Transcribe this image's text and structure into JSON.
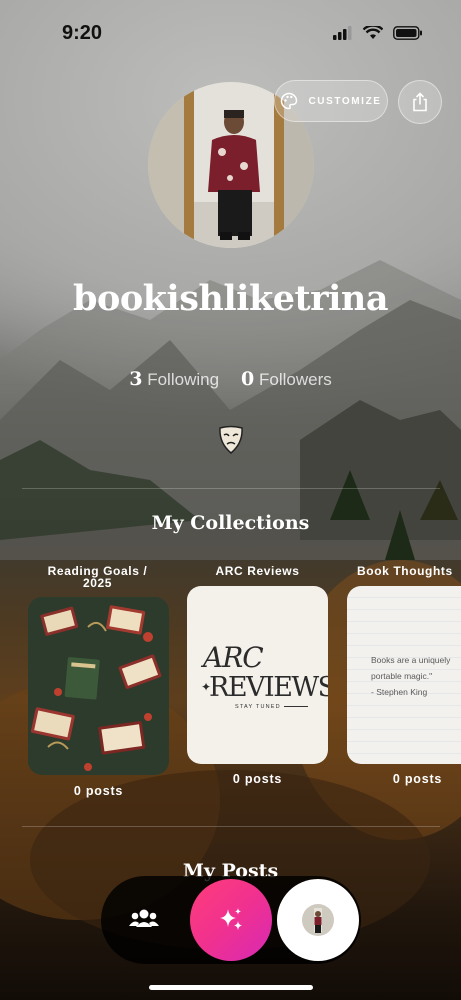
{
  "status_bar": {
    "time": "9:20"
  },
  "header": {
    "customize_label": "CUSTOMIZE"
  },
  "profile": {
    "username": "bookishliketrina",
    "following_count": "3",
    "following_label": "Following",
    "followers_count": "0",
    "followers_label": "Followers"
  },
  "collections_section": {
    "title": "My Collections",
    "items": [
      {
        "title_line1": "Reading Goals /",
        "title_line2": "2025",
        "posts": "0 posts"
      },
      {
        "title_line1": "ARC Reviews",
        "card_big1": "ARC",
        "card_big2": "REVIEWS",
        "card_small": "STAY TUNED",
        "posts": "0 posts"
      },
      {
        "title_line1": "Book Thoughts",
        "quote1": "Books are a uniquely",
        "quote2": "portable magic.\"",
        "quote3": "- Stephen King",
        "posts": "0 posts"
      }
    ]
  },
  "posts_section": {
    "title": "My Posts"
  },
  "colors": {
    "create_button": "#f0318f",
    "text": "#ffffff"
  },
  "icons": [
    "signal-icon",
    "wifi-icon",
    "battery-icon",
    "palette-icon",
    "share-icon",
    "mask-badge-icon",
    "people-icon",
    "sparkle-icon"
  ]
}
